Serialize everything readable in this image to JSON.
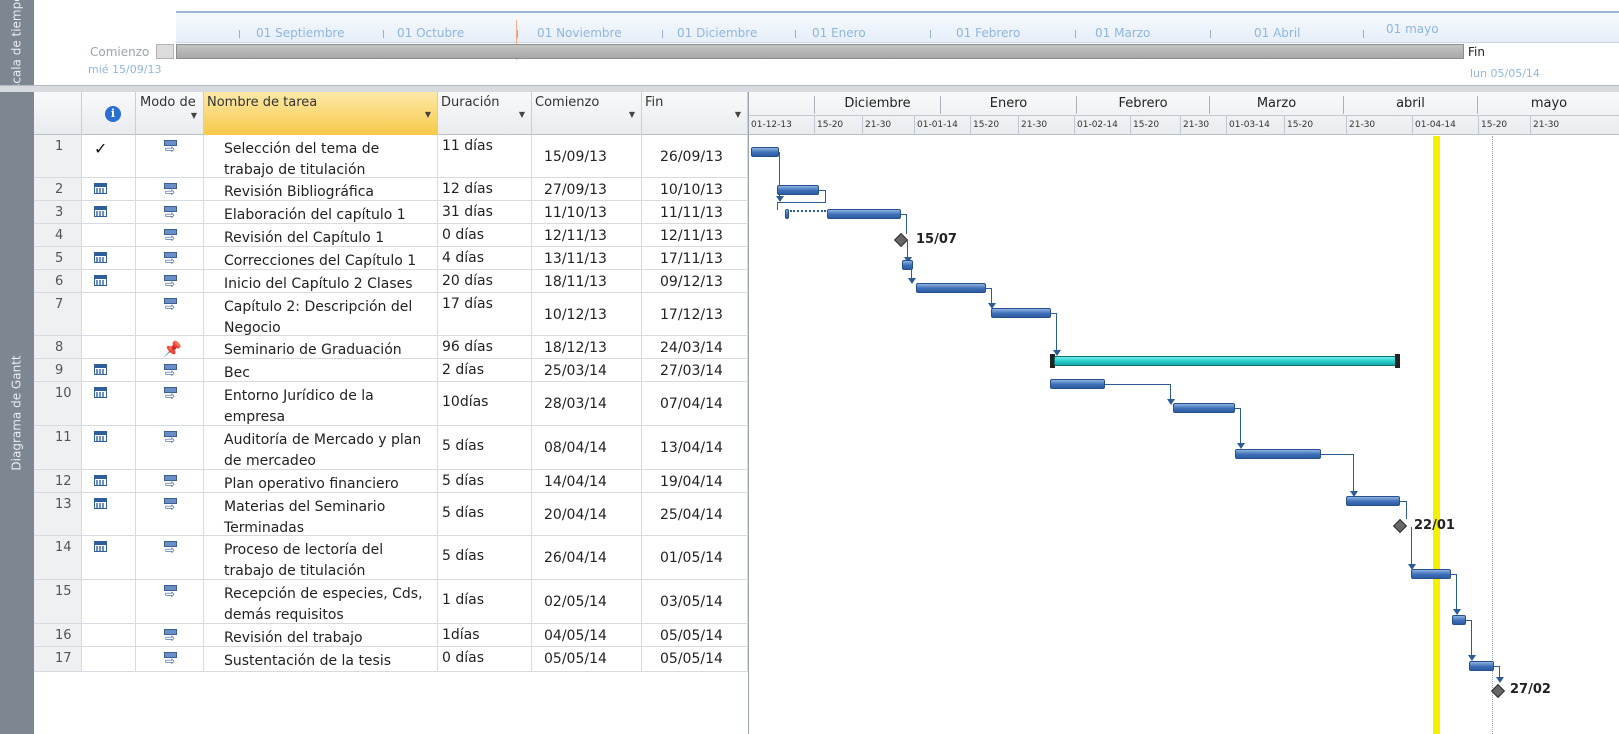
{
  "timeline": {
    "side_label": "Escala de tiempo",
    "months": [
      "01 Septiembre",
      "01 Octubre",
      "01 Noviembre",
      "01 Diciembre",
      "01 Enero",
      "01 Febrero",
      "01 Marzo",
      "01 Abril",
      "01 mayo"
    ],
    "start_label": "Comienzo",
    "start_date": "mié 15/09/13",
    "end_label": "Fin",
    "end_date": "lun 05/05/14"
  },
  "gantt_side_label": "Diagrama de Gantt",
  "table": {
    "headers": {
      "info": "i",
      "mode": "Modo de",
      "name": "Nombre de tarea",
      "duration": "Duración",
      "start": "Comienzo",
      "end": "Fin"
    },
    "rows": [
      {
        "id": "1",
        "indicator": "check",
        "mode": "auto",
        "name": "Selección del tema de trabajo de titulación",
        "duration": "11 días",
        "start": "15/09/13",
        "end": "26/09/13"
      },
      {
        "id": "2",
        "indicator": "calendar",
        "mode": "auto",
        "name": "Revisión Bibliográfica",
        "duration": "12 días",
        "start": "27/09/13",
        "end": "10/10/13"
      },
      {
        "id": "3",
        "indicator": "calendar",
        "mode": "auto",
        "name": "Elaboración del capítulo 1",
        "duration": "31 días",
        "start": "11/10/13",
        "end": "11/11/13"
      },
      {
        "id": "4",
        "indicator": "",
        "mode": "auto",
        "name": "Revisión del Capítulo 1",
        "duration": "0 días",
        "start": "12/11/13",
        "end": "12/11/13"
      },
      {
        "id": "5",
        "indicator": "calendar",
        "mode": "auto",
        "name": "Correcciones del Capítulo 1",
        "duration": "4 días",
        "start": "13/11/13",
        "end": "17/11/13"
      },
      {
        "id": "6",
        "indicator": "calendar",
        "mode": "auto",
        "name": "Inicio del Capítulo 2 Clases",
        "duration": "20 días",
        "start": "18/11/13",
        "end": "09/12/13"
      },
      {
        "id": "7",
        "indicator": "",
        "mode": "auto",
        "name": "Capítulo 2: Descripción del Negocio",
        "duration": "17 días",
        "start": "10/12/13",
        "end": "17/12/13"
      },
      {
        "id": "8",
        "indicator": "",
        "mode": "manual",
        "name": "Seminario de Graduación",
        "duration": "96 días",
        "start": "18/12/13",
        "end": "24/03/14"
      },
      {
        "id": "9",
        "indicator": "calendar",
        "mode": "auto",
        "name": "Bec",
        "duration": "2 días",
        "start": "25/03/14",
        "end": "27/03/14"
      },
      {
        "id": "10",
        "indicator": "calendar",
        "mode": "auto",
        "name": "Entorno Jurídico de la empresa",
        "duration": "10días",
        "start": "28/03/14",
        "end": "07/04/14"
      },
      {
        "id": "11",
        "indicator": "calendar",
        "mode": "auto",
        "name": "Auditoría de Mercado y plan de mercadeo",
        "duration": "5 días",
        "start": "08/04/14",
        "end": "13/04/14"
      },
      {
        "id": "12",
        "indicator": "calendar",
        "mode": "auto",
        "name": "Plan operativo financiero",
        "duration": "5 días",
        "start": "14/04/14",
        "end": "19/04/14"
      },
      {
        "id": "13",
        "indicator": "calendar",
        "mode": "auto",
        "name": "Materias del Seminario Terminadas",
        "duration": "5 días",
        "start": "20/04/14",
        "end": "25/04/14"
      },
      {
        "id": "14",
        "indicator": "calendar",
        "mode": "auto",
        "name": "Proceso de lectoría del trabajo de titulación",
        "duration": "5 días",
        "start": "26/04/14",
        "end": "01/05/14"
      },
      {
        "id": "15",
        "indicator": "",
        "mode": "auto",
        "name": "Recepción de especies, Cds, demás requisitos",
        "duration": "1 días",
        "start": "02/05/14",
        "end": "03/05/14"
      },
      {
        "id": "16",
        "indicator": "",
        "mode": "auto",
        "name": "Revisión del trabajo",
        "duration": "1días",
        "start": "04/05/14",
        "end": "05/05/14"
      },
      {
        "id": "17",
        "indicator": "",
        "mode": "auto",
        "name": "Sustentación de la tesis",
        "duration": "0 días",
        "start": "05/05/14",
        "end": "05/05/14"
      }
    ]
  },
  "chart": {
    "top_tier": [
      "Diciembre",
      "Enero",
      "Febrero",
      "Marzo",
      "abril",
      "mayo"
    ],
    "bottom_tier": [
      "01-12-13",
      "15-20",
      "21-30",
      "01-01-14",
      "15-20",
      "21-30",
      "01-02-14",
      "15-20",
      "21-30",
      "01-03-14",
      "15-20",
      "21-30",
      "01-04-14",
      "15-20",
      "21-30"
    ],
    "milestone_labels": [
      "15/07",
      "22/01",
      "27/02"
    ],
    "colors": {
      "task_bar": "#3d6fb7",
      "summary_bar": "#22c7c5",
      "today_line": "#f5f000"
    }
  }
}
